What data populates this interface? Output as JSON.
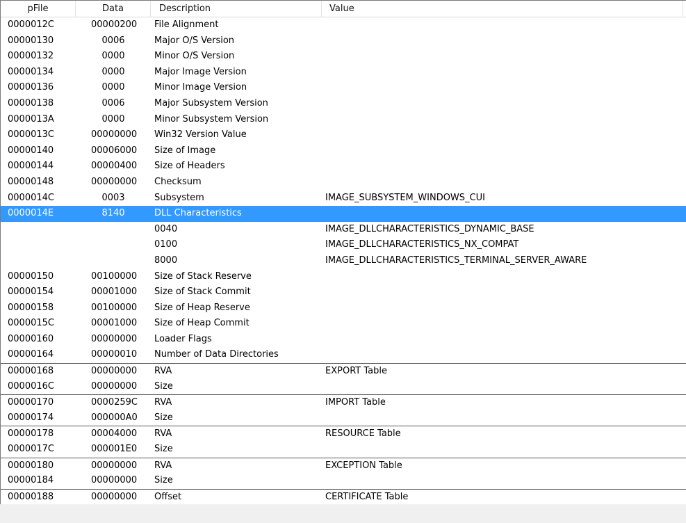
{
  "columns": {
    "pfile": "pFile",
    "data": "Data",
    "description": "Description",
    "value": "Value"
  },
  "rows": [
    {
      "pfile": "0000012C",
      "data": "00000200",
      "description": "File Alignment",
      "value": ""
    },
    {
      "pfile": "00000130",
      "data": "0006",
      "description": "Major O/S Version",
      "value": ""
    },
    {
      "pfile": "00000132",
      "data": "0000",
      "description": "Minor O/S Version",
      "value": ""
    },
    {
      "pfile": "00000134",
      "data": "0000",
      "description": "Major Image Version",
      "value": ""
    },
    {
      "pfile": "00000136",
      "data": "0000",
      "description": "Minor Image Version",
      "value": ""
    },
    {
      "pfile": "00000138",
      "data": "0006",
      "description": "Major Subsystem Version",
      "value": ""
    },
    {
      "pfile": "0000013A",
      "data": "0000",
      "description": "Minor Subsystem Version",
      "value": ""
    },
    {
      "pfile": "0000013C",
      "data": "00000000",
      "description": "Win32 Version Value",
      "value": ""
    },
    {
      "pfile": "00000140",
      "data": "00006000",
      "description": "Size of Image",
      "value": ""
    },
    {
      "pfile": "00000144",
      "data": "00000400",
      "description": "Size of Headers",
      "value": ""
    },
    {
      "pfile": "00000148",
      "data": "00000000",
      "description": "Checksum",
      "value": ""
    },
    {
      "pfile": "0000014C",
      "data": "0003",
      "description": "Subsystem",
      "value": "IMAGE_SUBSYSTEM_WINDOWS_CUI"
    },
    {
      "pfile": "0000014E",
      "data": "8140",
      "description": "DLL Characteristics",
      "value": "",
      "selected": true
    },
    {
      "pfile": "",
      "data": "",
      "description": "0040",
      "value": "IMAGE_DLLCHARACTERISTICS_DYNAMIC_BASE"
    },
    {
      "pfile": "",
      "data": "",
      "description": "0100",
      "value": "IMAGE_DLLCHARACTERISTICS_NX_COMPAT"
    },
    {
      "pfile": "",
      "data": "",
      "description": "8000",
      "value": "IMAGE_DLLCHARACTERISTICS_TERMINAL_SERVER_AWARE"
    },
    {
      "pfile": "00000150",
      "data": "00100000",
      "description": "Size of Stack Reserve",
      "value": ""
    },
    {
      "pfile": "00000154",
      "data": "00001000",
      "description": "Size of Stack Commit",
      "value": ""
    },
    {
      "pfile": "00000158",
      "data": "00100000",
      "description": "Size of Heap Reserve",
      "value": ""
    },
    {
      "pfile": "0000015C",
      "data": "00001000",
      "description": "Size of Heap Commit",
      "value": ""
    },
    {
      "pfile": "00000160",
      "data": "00000000",
      "description": "Loader Flags",
      "value": ""
    },
    {
      "pfile": "00000164",
      "data": "00000010",
      "description": "Number of Data Directories",
      "value": ""
    },
    {
      "pfile": "00000168",
      "data": "00000000",
      "description": "RVA",
      "value": "EXPORT Table",
      "sep": true
    },
    {
      "pfile": "0000016C",
      "data": "00000000",
      "description": "Size",
      "value": ""
    },
    {
      "pfile": "00000170",
      "data": "0000259C",
      "description": "RVA",
      "value": "IMPORT Table",
      "sep": true
    },
    {
      "pfile": "00000174",
      "data": "000000A0",
      "description": "Size",
      "value": ""
    },
    {
      "pfile": "00000178",
      "data": "00004000",
      "description": "RVA",
      "value": "RESOURCE Table",
      "sep": true
    },
    {
      "pfile": "0000017C",
      "data": "000001E0",
      "description": "Size",
      "value": ""
    },
    {
      "pfile": "00000180",
      "data": "00000000",
      "description": "RVA",
      "value": "EXCEPTION Table",
      "sep": true
    },
    {
      "pfile": "00000184",
      "data": "00000000",
      "description": "Size",
      "value": ""
    },
    {
      "pfile": "00000188",
      "data": "00000000",
      "description": "Offset",
      "value": "CERTIFICATE Table",
      "sep": true
    }
  ]
}
